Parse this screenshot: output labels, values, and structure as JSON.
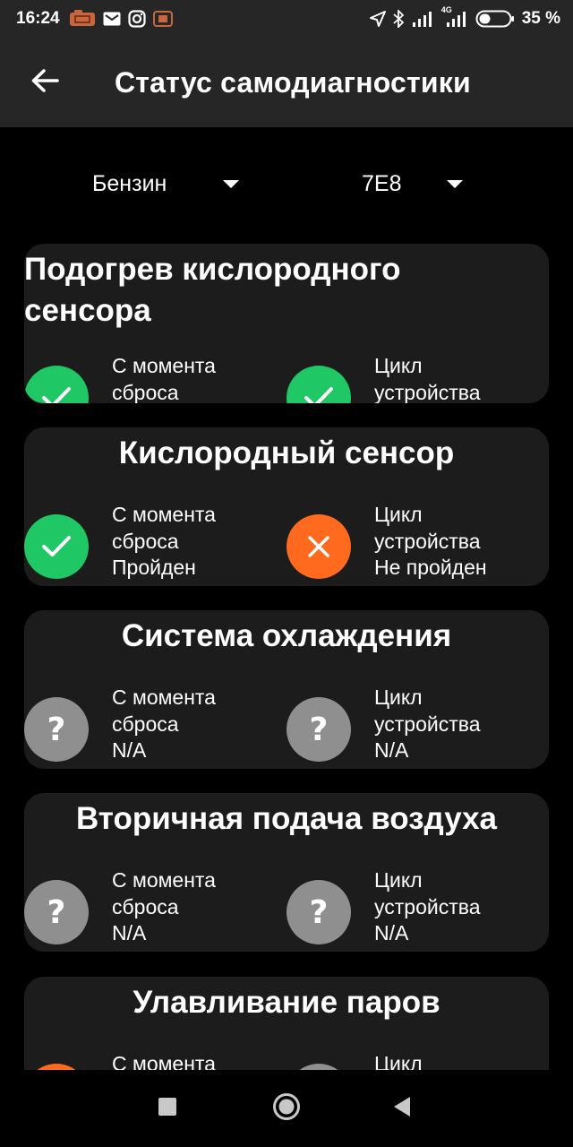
{
  "status_bar": {
    "time": "16:24",
    "battery": "35 %",
    "network": "4G"
  },
  "app_bar": {
    "title": "Статус самодиагностики"
  },
  "selectors": {
    "fuel": "Бензин",
    "ecu": "7E8"
  },
  "labels": {
    "since_reset": "С момента\nсброса",
    "drive_cycle": "Цикл\nустройства"
  },
  "cards": [
    {
      "title": "Подогрев кислородного сенсора",
      "since_reset": "Пройден",
      "drive_cycle": "Пройден"
    },
    {
      "title": "Кислородный сенсор",
      "since_reset": "Пройден",
      "drive_cycle": "Не пройден"
    },
    {
      "title": "Система охлаждения",
      "since_reset": "N/A",
      "drive_cycle": "N/A"
    },
    {
      "title": "Вторичная подача воздуха",
      "since_reset": "N/A",
      "drive_cycle": "N/A"
    },
    {
      "title": "Улавливание паров",
      "since_reset": "",
      "drive_cycle": ""
    }
  ],
  "colors": {
    "pass": "#1fc765",
    "fail": "#ff6a1f",
    "na": "#8f8f8f",
    "card": "#1c1c1c",
    "bar": "#262626"
  }
}
